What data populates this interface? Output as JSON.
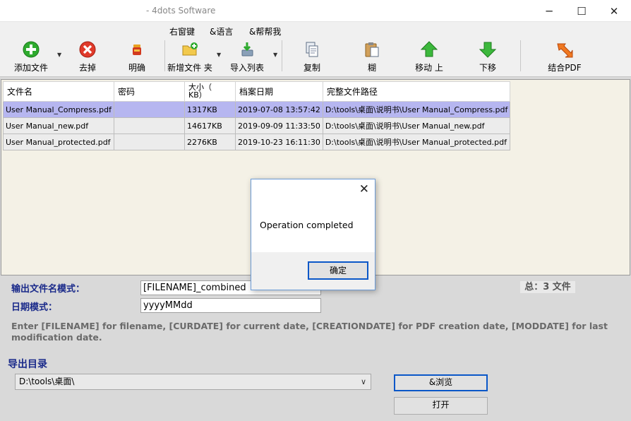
{
  "window": {
    "title": "- 4dots Software",
    "minimize": "─",
    "maximize": "☐",
    "close": "✕"
  },
  "menu": [
    "右窗键",
    "&语言",
    "&帮帮我"
  ],
  "toolbar": {
    "add_files": "添加文件",
    "remove": "去掉",
    "clear": "明确",
    "add_folder": "新增文件 夹",
    "import_list": "导入列表",
    "copy": "复制",
    "paste": "糊",
    "move_up": "移动 上",
    "move_down": "下移",
    "merge_pdf": "结合PDF"
  },
  "table": {
    "headers": [
      "文件名",
      "密码",
      "大小（\nKB）",
      "档案日期",
      "完整文件路径"
    ],
    "rows": [
      [
        "User Manual_Compress.pdf",
        "",
        "1317KB",
        "2019-07-08 13:57:42",
        "D:\\tools\\桌面\\说明书\\User Manual_Compress.pdf"
      ],
      [
        "User Manual_new.pdf",
        "",
        "14617KB",
        "2019-09-09 11:33:50",
        "D:\\tools\\桌面\\说明书\\User Manual_new.pdf"
      ],
      [
        "User Manual_protected.pdf",
        "",
        "2276KB",
        "2019-10-23 16:11:30",
        "D:\\tools\\桌面\\说明书\\User Manual_protected.pdf"
      ]
    ]
  },
  "output": {
    "filename_pattern_label": "输出文件名模式：",
    "filename_pattern_value": "[FILENAME]_combined",
    "date_pattern_label": "日期模式：",
    "date_pattern_value": "yyyyMMdd",
    "hint": "Enter [FILENAME] for filename, [CURDATE] for current date, [CREATIONDATE] for PDF creation date, [MODDATE] for last modification date.",
    "total": "总：3 文件",
    "folder_label": "导出目录",
    "folder_value": "D:\\tools\\桌面\\",
    "browse": "&浏览",
    "open": "打开"
  },
  "dialog": {
    "message": "Operation completed",
    "ok": "确定",
    "close": "✕"
  },
  "colors": {
    "selected_row": "#b6b6f0",
    "label_blue": "#1a2a8a",
    "focus_border": "#0a57c8",
    "grid_bg": "#f4f1e6"
  }
}
